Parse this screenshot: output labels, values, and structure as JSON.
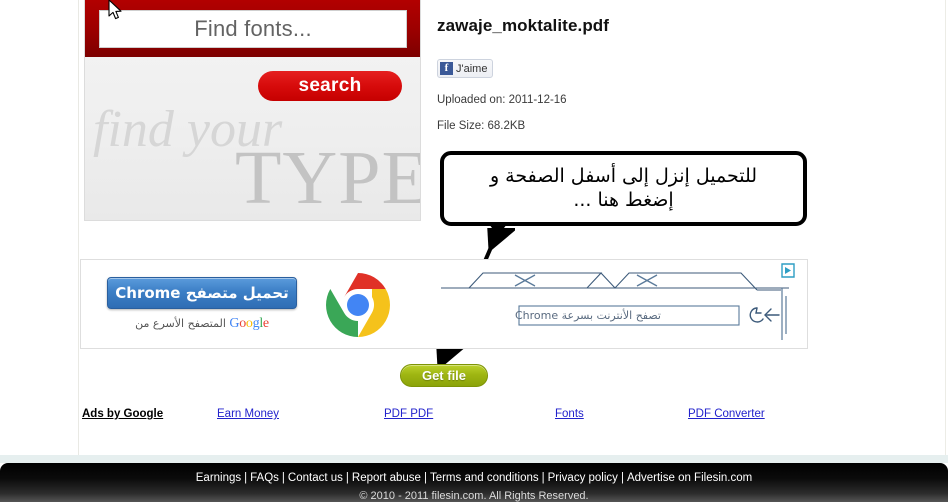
{
  "banner": {
    "search_placeholder": "Find fonts...",
    "search_button_label": "search",
    "tagline_italic": "find your",
    "tagline_caps": "TYPE"
  },
  "file": {
    "title": "zawaje_moktalite.pdf",
    "facebook_like_label": "J'aime",
    "facebook_icon": "facebook-f-icon",
    "uploaded_on": "Uploaded on: 2011-12-16",
    "file_size": "File Size: 68.2KB"
  },
  "callout": {
    "line1": "للتحميل إنزل إلى أسفل الصفحة و",
    "line2": "إضغط هنا ..."
  },
  "ad": {
    "chrome_button_label": "تحميل متصفح Chrome",
    "chrome_subtext_prefix": "المتصفح الأسرع من",
    "google_wordmark": "Google",
    "browser_url_text": "تصفح الأنترنت بسرعة Chrome",
    "adchoices_icon": "adchoices-icon",
    "chrome_logo_icon": "chrome-logo-icon"
  },
  "actions": {
    "get_file_label": "Get file"
  },
  "ads_by_google": {
    "label": "Ads by Google",
    "links": [
      "Earn Money",
      "PDF PDF",
      "Fonts",
      "PDF Converter"
    ]
  },
  "footer": {
    "links": [
      "Earnings",
      "FAQs",
      "Contact us",
      "Report abuse",
      "Terms and conditions",
      "Privacy policy",
      "Advertise on Filesin.com"
    ],
    "copyright": "© 2010 - 2011 filesin.com. All Rights Reserved."
  },
  "colors": {
    "banner_red": "#9e0000",
    "search_red": "#d70b0b",
    "get_file_green": "#9fb612",
    "link_blue": "#2222cc",
    "chrome_blue": "#3c7fc6",
    "footer_black": "#000000"
  }
}
